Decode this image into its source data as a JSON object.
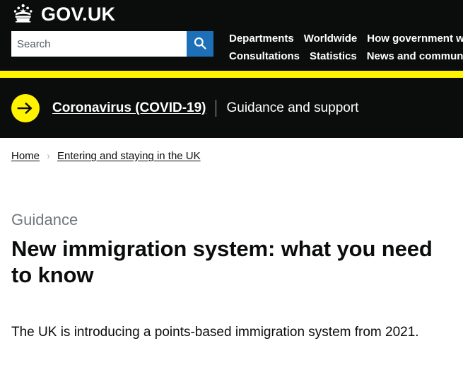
{
  "header": {
    "logo_text": "GOV.UK",
    "crown_icon": "crown-icon",
    "search": {
      "placeholder": "Search",
      "value": "",
      "button_icon": "search-icon",
      "button_color": "#1d70b8"
    },
    "nav": {
      "row1": [
        {
          "label": "Departments"
        },
        {
          "label": "Worldwide"
        },
        {
          "label": "How government works"
        }
      ],
      "row2": [
        {
          "label": "Consultations"
        },
        {
          "label": "Statistics"
        },
        {
          "label": "News and communications"
        }
      ]
    },
    "accent_yellow": "#fff300",
    "background": "#0b0c0c"
  },
  "covid_banner": {
    "arrow_icon": "arrow-right-icon",
    "link_label": "Coronavirus (COVID-19)",
    "separator": "|",
    "subtitle": "Guidance and support"
  },
  "breadcrumbs": {
    "items": [
      {
        "label": "Home"
      },
      {
        "label": "Entering and staying in the UK"
      }
    ],
    "separator": "›"
  },
  "main": {
    "context_label": "Guidance",
    "title": "New immigration system: what you need to know",
    "lead_paragraph": "The UK is introducing a points-based immigration system from 2021."
  }
}
